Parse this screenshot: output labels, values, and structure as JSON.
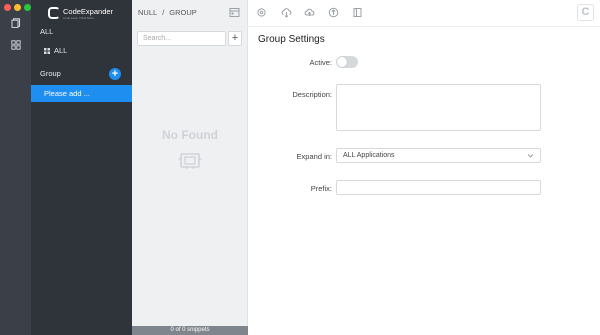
{
  "app": {
    "name": "CodeExpander",
    "tagline": "Code Less, Think More"
  },
  "breadcrumb": {
    "root": "NULL",
    "sep": "/",
    "current": "GROUP"
  },
  "sidebar": {
    "all_heading": "ALL",
    "all_item": "ALL",
    "group_heading": "Group",
    "groups": [
      {
        "label": "Please add ..."
      }
    ]
  },
  "snippets": {
    "search_placeholder": "Search...",
    "empty_text": "No Found",
    "status": "0 of 0 snippets"
  },
  "toolbar": {
    "icons": [
      "snippet-preview-icon",
      "settings-icon",
      "cloud-download-icon",
      "cloud-upload-icon",
      "upload-icon",
      "book-icon"
    ]
  },
  "form": {
    "title": "Group Settings",
    "active_label": "Active:",
    "active_value": false,
    "description_label": "Description:",
    "description_value": "",
    "expand_label": "Expand in:",
    "expand_value": "ALL Applications",
    "prefix_label": "Prefix:",
    "prefix_value": ""
  },
  "colors": {
    "accent": "#1f8ef1",
    "rail": "#3b3f47",
    "sidebar": "#2f333a"
  }
}
